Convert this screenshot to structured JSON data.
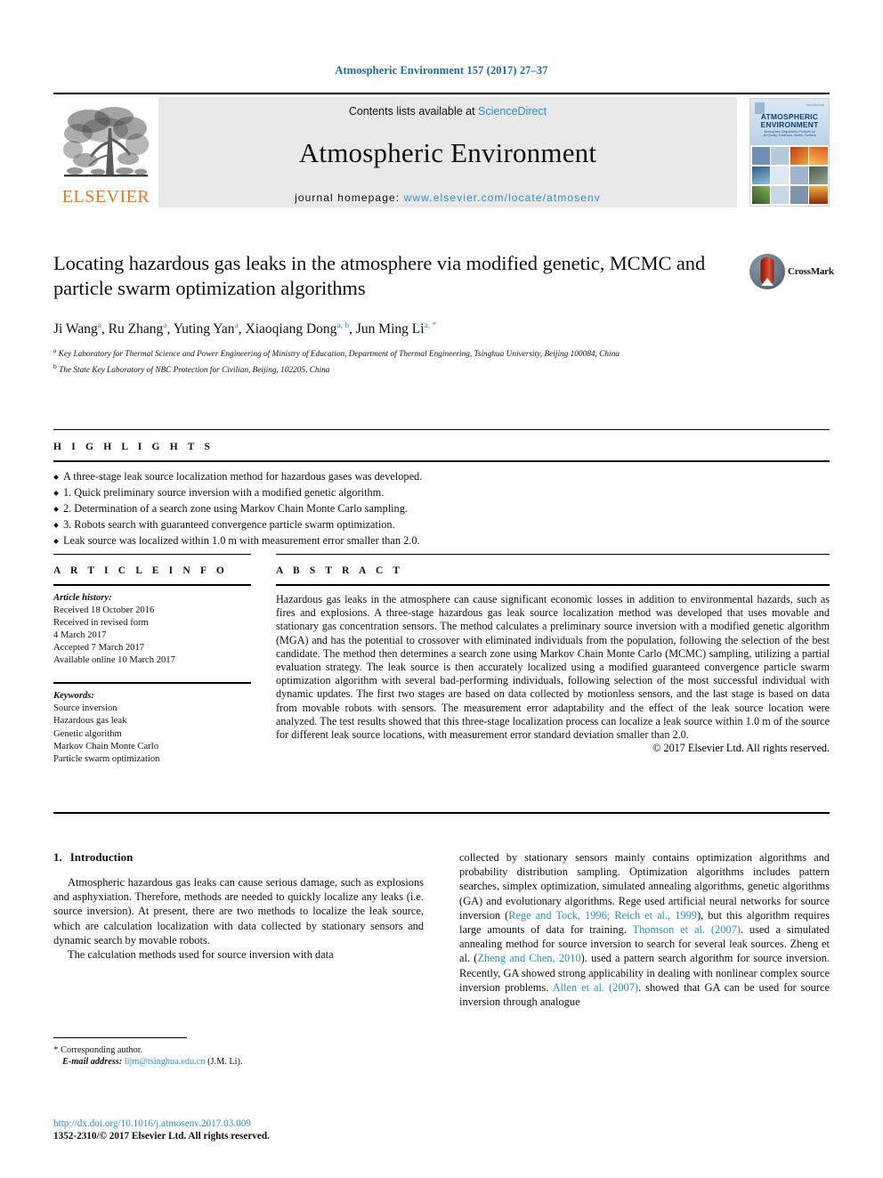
{
  "running_head": "Atmospheric Environment 157 (2017) 27–37",
  "banner": {
    "contents_prefix": "Contents lists available at ",
    "sciencedirect": "ScienceDirect",
    "journal_name": "Atmospheric Environment",
    "homepage_prefix": "journal homepage: ",
    "homepage_url": "www.elsevier.com/locate/atmosenv",
    "elsevier_wordmark": "ELSEVIER",
    "cover": {
      "title_line1": "ATMOSPHERIC",
      "title_line2": "ENVIRONMENT",
      "subtitle_line1": "Atmospheric Degradation Products for",
      "subtitle_line2": "Air Quality, Emissions, Health, Particles",
      "code": "ISSN 1352-2310"
    },
    "accent_blue": "#2a8fd0",
    "elsevier_orange": "#E87722",
    "banner_gray": "#e8e8e8"
  },
  "article": {
    "title": "Locating hazardous gas leaks in the atmosphere via modified genetic, MCMC and particle swarm optimization algorithms",
    "crossmark_label": "CrossMark",
    "authors": [
      {
        "name": "Ji Wang",
        "marks": "a"
      },
      {
        "name": "Ru Zhang",
        "marks": "a"
      },
      {
        "name": "Yuting Yan",
        "marks": "a"
      },
      {
        "name": "Xiaoqiang Dong",
        "marks": "a, b"
      },
      {
        "name": "Jun Ming Li",
        "marks": "a, *"
      }
    ],
    "affiliations": [
      {
        "mark": "a",
        "text": "Key Laboratory for Thermal Science and Power Engineering of Ministry of Education, Department of Thermal Engineering, Tsinghua University, Beijing 100084, China"
      },
      {
        "mark": "b",
        "text": "The State Key Laboratory of NBC Protection for Civilian, Beijing, 102205, China"
      }
    ]
  },
  "highlights": {
    "heading": "H I G H L I G H T S",
    "items": [
      "A three-stage leak source localization method for hazardous gases was developed.",
      "1. Quick preliminary source inversion with a modified genetic algorithm.",
      "2. Determination of a search zone using Markov Chain Monte Carlo sampling.",
      "3. Robots search with guaranteed convergence particle swarm optimization.",
      "Leak source was localized within 1.0 m with measurement error smaller than 2.0."
    ]
  },
  "article_info": {
    "heading": "A R T I C L E  I N F O",
    "history_label": "Article history:",
    "history": [
      "Received 18 October 2016",
      "Received in revised form",
      "4 March 2017",
      "Accepted 7 March 2017",
      "Available online 10 March 2017"
    ],
    "keywords_label": "Keywords:",
    "keywords": [
      "Source inversion",
      "Hazardous gas leak",
      "Genetic algorithm",
      "Markov Chain Monte Carlo",
      "Particle swarm optimization"
    ]
  },
  "abstract": {
    "heading": "A B S T R A C T",
    "text": "Hazardous gas leaks in the atmosphere can cause significant economic losses in addition to environmental hazards, such as fires and explosions. A three-stage hazardous gas leak source localization method was developed that uses movable and stationary gas concentration sensors. The method calculates a preliminary source inversion with a modified genetic algorithm (MGA) and has the potential to crossover with eliminated individuals from the population, following the selection of the best candidate. The method then determines a search zone using Markov Chain Monte Carlo (MCMC) sampling, utilizing a partial evaluation strategy. The leak source is then accurately localized using a modified guaranteed convergence particle swarm optimization algorithm with several bad-performing individuals, following selection of the most successful individual with dynamic updates. The first two stages are based on data collected by motionless sensors, and the last stage is based on data from movable robots with sensors. The measurement error adaptability and the effect of the leak source location were analyzed. The test results showed that this three-stage localization process can localize a leak source within 1.0 m of the source for different leak source locations, with measurement error standard deviation smaller than 2.0.",
    "copyright": "© 2017 Elsevier Ltd. All rights reserved."
  },
  "introduction": {
    "number": "1.",
    "title": "Introduction",
    "left_paragraphs": [
      "Atmospheric hazardous gas leaks can cause serious damage, such as explosions and asphyxiation. Therefore, methods are needed to quickly localize any leaks (i.e. source inversion). At present, there are two methods to localize the leak source, which are calculation localization with data collected by stationary sensors and dynamic search by movable robots.",
      "The calculation methods used for source inversion with data"
    ],
    "right_segments": [
      {
        "t": "collected by stationary sensors mainly contains optimization algorithms and probability distribution sampling. Optimization algorithms includes pattern searches, simplex optimization, simulated annealing algorithms, genetic algorithms (GA) and evolutionary algorithms. Rege used artificial neural networks for source inversion (",
        "link": false
      },
      {
        "t": "Rege and Tock, 1996; Reich et al., 1999",
        "link": true
      },
      {
        "t": "), but this algorithm requires large amounts of data for training. ",
        "link": false
      },
      {
        "t": "Thomson et al. (2007)",
        "link": true
      },
      {
        "t": ". used a simulated annealing method for source inversion to search for several leak sources. Zheng et al. (",
        "link": false
      },
      {
        "t": "Zheng and Chen, 2010",
        "link": true
      },
      {
        "t": "). used a pattern search algorithm for source inversion. Recently, GA showed strong applicability in dealing with nonlinear complex source inversion problems. ",
        "link": false
      },
      {
        "t": "Allen et al. (2007)",
        "link": true
      },
      {
        "t": ". showed that GA can be used for source inversion through analogue",
        "link": false
      }
    ]
  },
  "footnotes": {
    "corresponding_marker": "*",
    "corresponding_text": "Corresponding author.",
    "email_label": "E-mail address:",
    "email": "lijm@tsinghua.edu.cn",
    "email_owner": "(J.M. Li).",
    "doi": "http://dx.doi.org/10.1016/j.atmosenv.2017.03.009",
    "issn_line": "1352-2310/© 2017 Elsevier Ltd. All rights reserved."
  }
}
